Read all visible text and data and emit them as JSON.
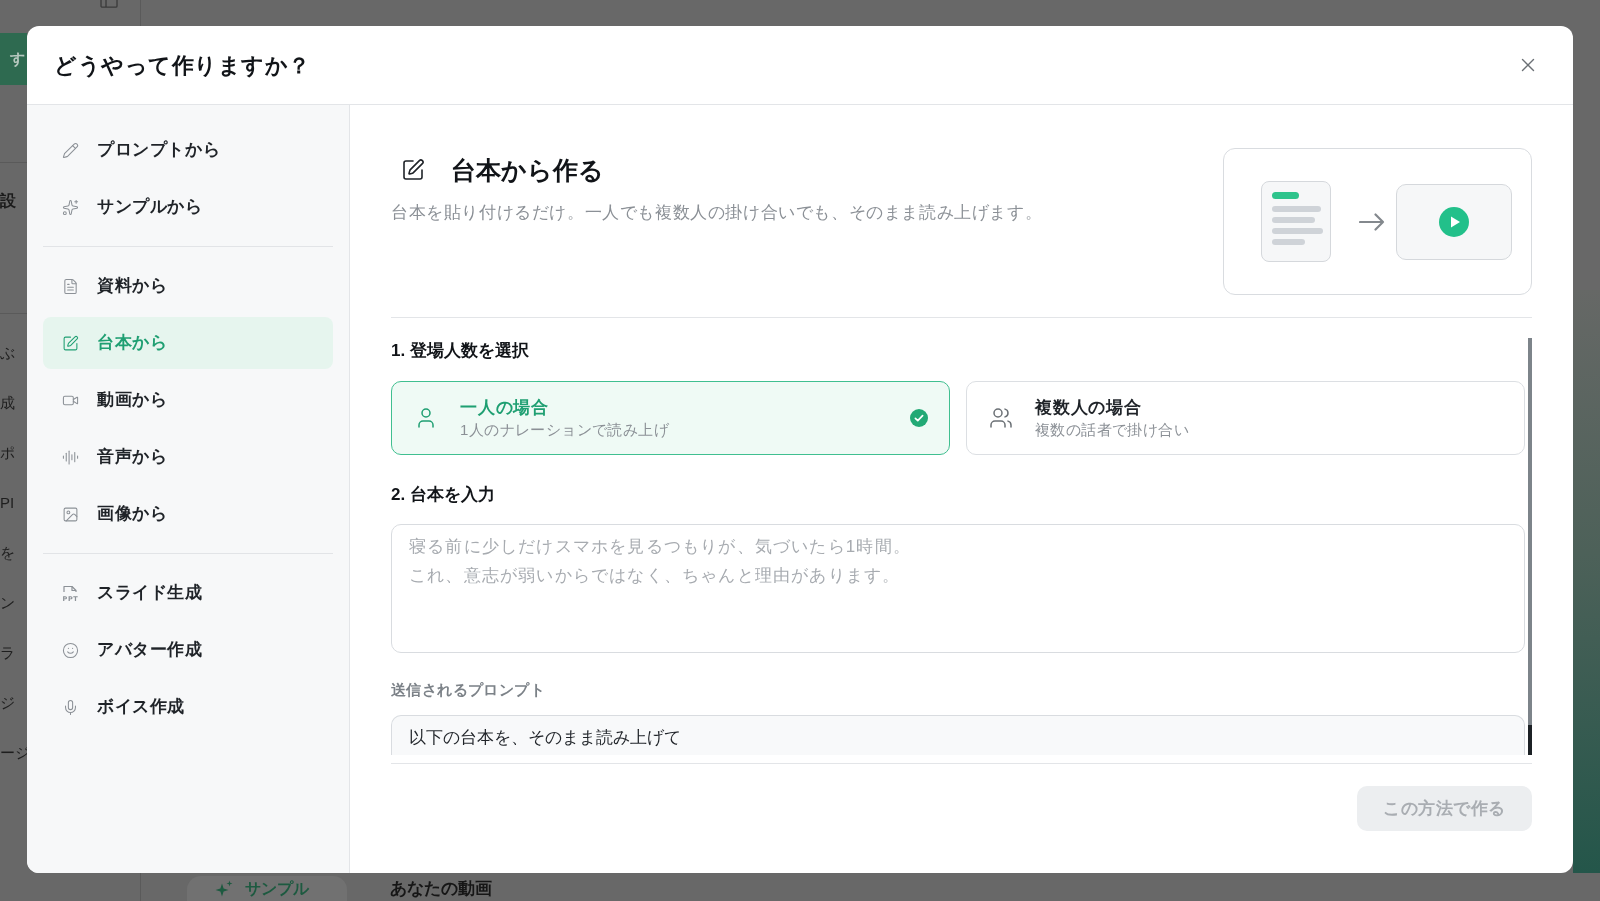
{
  "background_app": {
    "nav_button": "す",
    "nav_heading": "設",
    "nav_items": [
      "ぶ",
      "成",
      "ポ",
      "PI",
      "を",
      "ン",
      "ラ",
      "ジ",
      "ージ"
    ],
    "sample_button": "サンプル",
    "section_title": "あなたの動画"
  },
  "dialog": {
    "title": "どうやって作りますか？",
    "sidebar": {
      "groups": [
        {
          "items": [
            {
              "label": "プロンプトから",
              "selected": false
            },
            {
              "label": "サンプルから",
              "selected": false
            }
          ]
        },
        {
          "items": [
            {
              "label": "資料から",
              "selected": false
            },
            {
              "label": "台本から",
              "selected": true
            },
            {
              "label": "動画から",
              "selected": false
            },
            {
              "label": "音声から",
              "selected": false
            },
            {
              "label": "画像から",
              "selected": false
            }
          ]
        },
        {
          "items": [
            {
              "label": "スライド生成",
              "selected": false,
              "icon_text": "PPT"
            },
            {
              "label": "アバター作成",
              "selected": false
            },
            {
              "label": "ボイス作成",
              "selected": false
            }
          ]
        }
      ]
    },
    "content": {
      "title": "台本から作る",
      "description": "台本を貼り付けるだけ。一人でも複数人の掛け合いでも、そのまま読み上げます。",
      "step1": {
        "label": "1. 登場人数を選択",
        "options": [
          {
            "title": "一人の場合",
            "subtitle": "1人のナレーションで読み上げ",
            "selected": true
          },
          {
            "title": "複数人の場合",
            "subtitle": "複数の話者で掛け合い",
            "selected": false
          }
        ]
      },
      "step2": {
        "label": "2. 台本を入力",
        "placeholder": "寝る前に少しだけスマホを見るつもりが、気づいたら1時間。これ、意志が弱いからではなく、ちゃんと理由があります。"
      },
      "prompt_preview": {
        "label": "送信されるプロンプト",
        "text": "以下の台本を、そのまま読み上げて"
      }
    },
    "submit_button": {
      "label": "この方法で作る",
      "disabled": true
    }
  }
}
